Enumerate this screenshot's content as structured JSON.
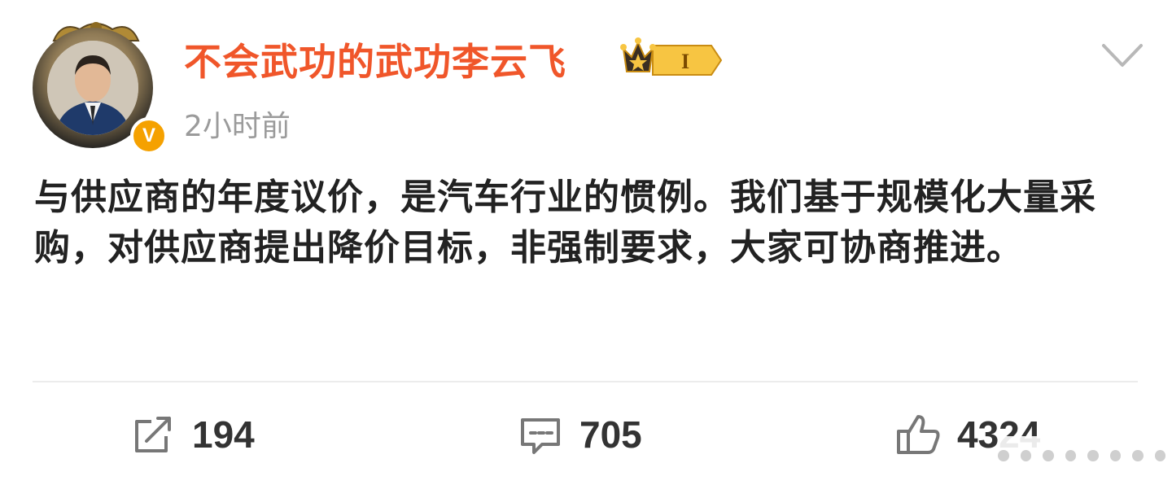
{
  "post": {
    "username": "不会武功的武功李云飞",
    "level": "I",
    "verified_mark": "V",
    "timestamp": "2小时前",
    "text": "与供应商的年度议价，是汽车行业的惯例。我们基于规模化大量采购，对供应商提出降价目标，非强制要求，大家可协商推进。"
  },
  "actions": {
    "repost_count": "194",
    "comment_count": "705",
    "like_count": "4324"
  },
  "icons": {
    "menu": "chevron-down-icon",
    "repost": "share-icon",
    "comment": "comment-icon",
    "like": "thumbs-up-icon"
  },
  "colors": {
    "username": "#f0562a",
    "timestamp": "#9b9b9b",
    "verified": "#f5a100",
    "level_badge": "#f7c542"
  }
}
